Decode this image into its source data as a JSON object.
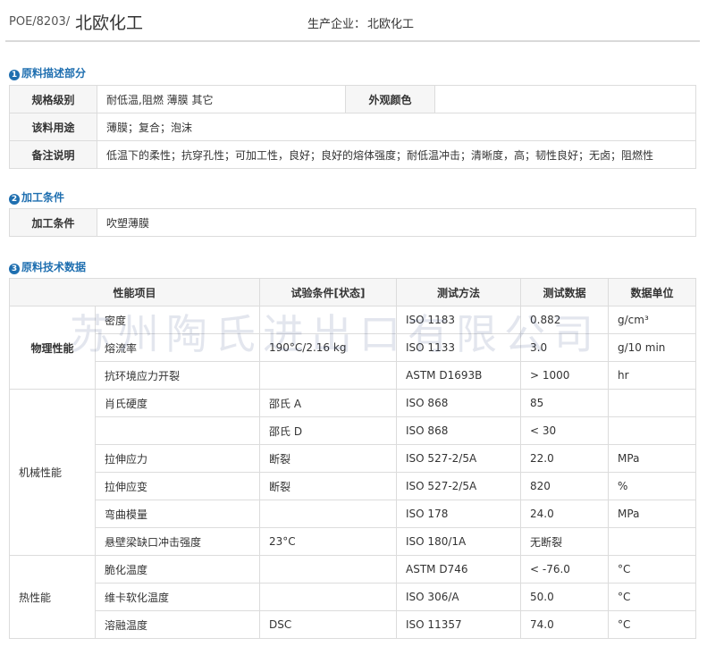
{
  "header": {
    "grade": "POE/8203/",
    "brand": "北欧化工",
    "producer_label": "生产企业：",
    "producer": "北欧化工"
  },
  "section1": {
    "num": "1",
    "title": "原料描述部分",
    "rows": {
      "spec_label": "规格级别",
      "spec_value": "耐低温,阻燃 薄膜 其它",
      "color_label": "外观颜色",
      "color_value": "",
      "use_label": "该料用途",
      "use_value": "薄膜；复合；泡沫",
      "note_label": "备注说明",
      "note_value": "低温下的柔性；抗穿孔性；可加工性，良好；良好的熔体强度；耐低温冲击；清晰度，高；韧性良好；无卤；阻燃性"
    }
  },
  "section2": {
    "num": "2",
    "title": "加工条件",
    "label": "加工条件",
    "value": "吹塑薄膜"
  },
  "section3": {
    "num": "3",
    "title": "原料技术数据",
    "headers": [
      "性能项目",
      "试验条件[状态]",
      "测试方法",
      "测试数据",
      "数据单位"
    ],
    "groups": {
      "physical": "物理性能",
      "mechanical": "机械性能",
      "thermal": "热性能"
    },
    "rows": [
      [
        "密度",
        "",
        "ISO 1183",
        "0.882",
        "g/cm³"
      ],
      [
        "熔流率",
        "190°C/2.16 kg",
        "ISO 1133",
        "3.0",
        "g/10 min"
      ],
      [
        "抗环境应力开裂",
        "",
        "ASTM D1693B",
        "> 1000",
        "hr"
      ],
      [
        "肖氏硬度",
        "邵氏 A",
        "ISO 868",
        "85",
        ""
      ],
      [
        "",
        "邵氏 D",
        "ISO 868",
        "< 30",
        ""
      ],
      [
        "拉伸应力",
        "断裂",
        "ISO 527-2/5A",
        "22.0",
        "MPa"
      ],
      [
        "拉伸应变",
        "断裂",
        "ISO 527-2/5A",
        "820",
        "%"
      ],
      [
        "弯曲模量",
        "",
        "ISO 178",
        "24.0",
        "MPa"
      ],
      [
        "悬壁梁缺口冲击强度",
        "23°C",
        "ISO 180/1A",
        "无断裂",
        ""
      ],
      [
        "脆化温度",
        "",
        "ASTM D746",
        "< -76.0",
        "°C"
      ],
      [
        "维卡软化温度",
        "",
        "ISO 306/A",
        "50.0",
        "°C"
      ],
      [
        "溶融温度",
        "DSC",
        "ISO 11357",
        "74.0",
        "°C"
      ]
    ]
  },
  "watermark": "苏州陶氏进出口有限公司"
}
